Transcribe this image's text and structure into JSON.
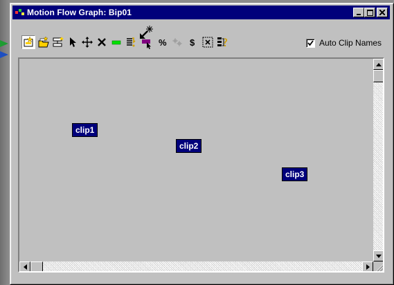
{
  "window": {
    "title": "Motion Flow Graph: Bip01",
    "title_bar_color": "#00007b",
    "buttons": [
      "minimize-icon",
      "maximize-icon",
      "close-icon"
    ]
  },
  "toolbar": {
    "tools": [
      {
        "name": "create-clip-icon",
        "pressed": true
      },
      {
        "name": "create-multiple-clips-icon",
        "pressed": false
      },
      {
        "name": "create-transition-icon",
        "pressed": false
      },
      {
        "name": "select-arrow-icon",
        "pressed": false
      },
      {
        "name": "move-clips-icon",
        "pressed": false
      },
      {
        "name": "delete-icon",
        "pressed": false
      },
      {
        "name": "create-random-motion-icon",
        "pressed": false
      },
      {
        "name": "show-scripts-icon",
        "pressed": false
      },
      {
        "name": "select-random-start-clip-icon",
        "pressed": false
      },
      {
        "name": "transition-percentage-icon",
        "pressed": false
      },
      {
        "name": "optimize-transitions-icon",
        "pressed": false
      },
      {
        "name": "compute-cost-icon",
        "pressed": false
      },
      {
        "name": "zoom-extents-icon",
        "pressed": false
      },
      {
        "name": "clip-info-icon",
        "pressed": false
      }
    ],
    "auto_clip_names": {
      "label": "Auto Clip Names",
      "checked": true
    }
  },
  "clips": [
    {
      "label": "clip1"
    },
    {
      "label": "clip2"
    },
    {
      "label": "clip3"
    }
  ],
  "colors": {
    "clip_fill": "#00007b",
    "clip_text": "#ffffff",
    "canvas_bg": "#c0c0c0"
  }
}
